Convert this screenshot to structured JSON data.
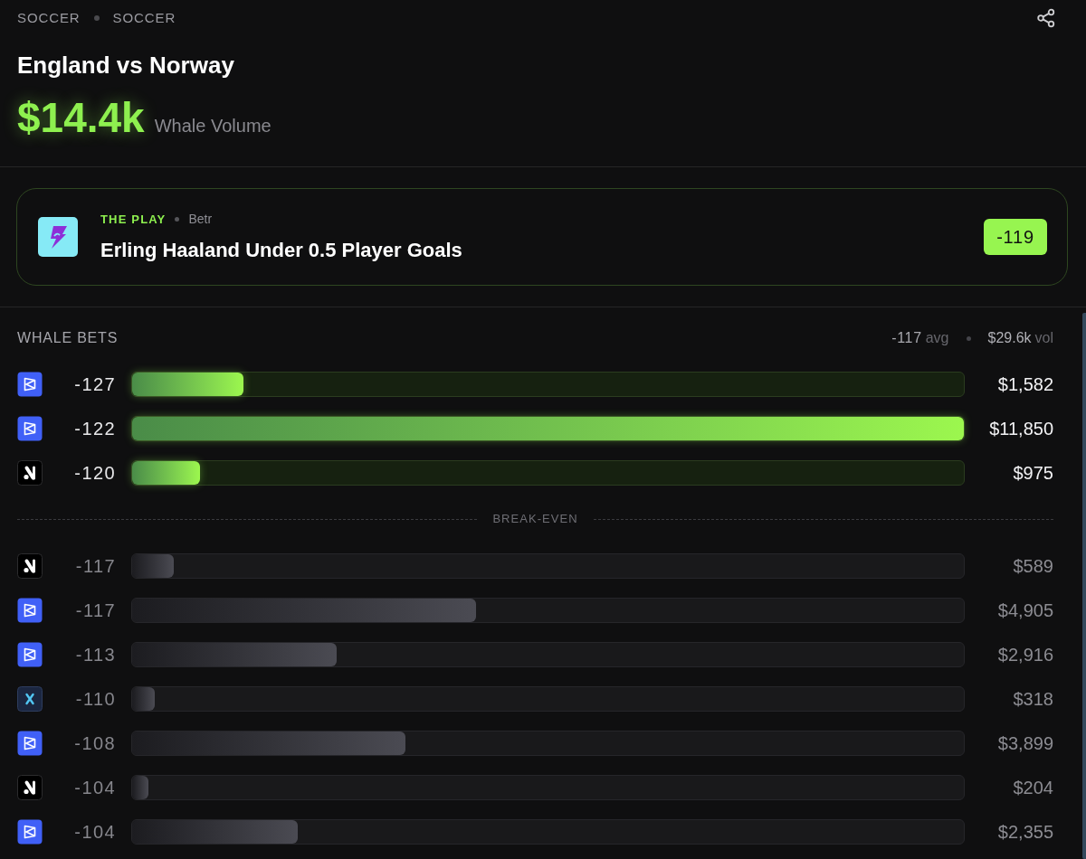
{
  "breadcrumb": [
    "SOCCER",
    "SOCCER"
  ],
  "title": "England vs Norway",
  "whale_volume": {
    "value": "$14.4k",
    "label": "Whale Volume"
  },
  "the_play": {
    "label": "THE PLAY",
    "book": "Betr",
    "pick": "Erling Haaland Under 0.5 Player Goals",
    "odds": "-119"
  },
  "whale_bets": {
    "title": "WHALE BETS",
    "avg": {
      "value": "-117",
      "unit": "avg"
    },
    "vol": {
      "value": "$29.6k",
      "unit": "vol"
    },
    "above": [
      {
        "kind": "prism",
        "odds": "-127",
        "level": 0.134,
        "amount": "$1,582"
      },
      {
        "kind": "prism",
        "odds": "-122",
        "level": 1,
        "amount": "$11,850"
      },
      {
        "kind": "slash",
        "odds": "-120",
        "level": 0.082,
        "amount": "$975"
      }
    ],
    "break_even": "BREAK-EVEN",
    "below": [
      {
        "kind": "slash",
        "odds": "-117",
        "level": 0.05,
        "amount": "$589"
      },
      {
        "kind": "prism",
        "odds": "-117",
        "level": 0.414,
        "amount": "$4,905"
      },
      {
        "kind": "prism",
        "odds": "-113",
        "level": 0.246,
        "amount": "$2,916"
      },
      {
        "kind": "cross",
        "odds": "-110",
        "level": 0.027,
        "amount": "$318"
      },
      {
        "kind": "prism",
        "odds": "-108",
        "level": 0.329,
        "amount": "$3,899"
      },
      {
        "kind": "slash",
        "odds": "-104",
        "level": 0.02,
        "amount": "$204"
      },
      {
        "kind": "prism",
        "odds": "-104",
        "level": 0.199,
        "amount": "$2,355"
      }
    ]
  }
}
